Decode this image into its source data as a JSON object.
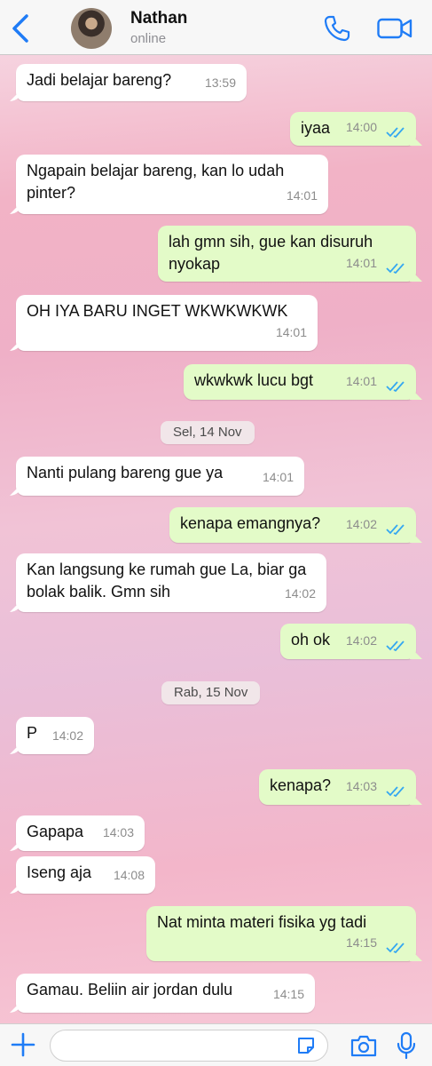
{
  "header": {
    "back_icon": "chevron-left-icon",
    "contact_name": "Nathan",
    "status": "online",
    "call_icon": "phone-icon",
    "video_icon": "video-camera-icon",
    "accent_color": "#1f7cf6"
  },
  "messages": [
    {
      "side": "in",
      "text": "Jadi belajar bareng?",
      "time": "13:59"
    },
    {
      "side": "out",
      "text": "iyaa",
      "time": "14:00",
      "read": true
    },
    {
      "side": "in",
      "text": "Ngapain belajar bareng, kan lo udah pinter?",
      "time": "14:01"
    },
    {
      "side": "out",
      "text": "lah gmn sih, gue kan disuruh nyokap",
      "time": "14:01",
      "read": true
    },
    {
      "side": "in",
      "text": "OH IYA BARU INGET WKWKWKWK",
      "time": "14:01"
    },
    {
      "side": "out",
      "text": "wkwkwk lucu bgt",
      "time": "14:01",
      "read": true
    },
    {
      "side": "date",
      "text": "Sel, 14 Nov"
    },
    {
      "side": "in",
      "text": "Nanti pulang bareng gue ya",
      "time": "14:01"
    },
    {
      "side": "out",
      "text": "kenapa emangnya?",
      "time": "14:02",
      "read": true
    },
    {
      "side": "in",
      "text": "Kan langsung ke rumah gue La, biar ga bolak balik. Gmn sih",
      "time": "14:02"
    },
    {
      "side": "out",
      "text": "oh ok",
      "time": "14:02",
      "read": true
    },
    {
      "side": "date",
      "text": "Rab, 15 Nov"
    },
    {
      "side": "in",
      "text": "P",
      "time": "14:02"
    },
    {
      "side": "out",
      "text": "kenapa?",
      "time": "14:03",
      "read": true
    },
    {
      "side": "in",
      "text": "Gapapa",
      "time": "14:03"
    },
    {
      "side": "in",
      "text": "Iseng aja",
      "time": "14:08"
    },
    {
      "side": "out",
      "text": "Nat minta materi fisika yg tadi",
      "time": "14:15",
      "read": true
    },
    {
      "side": "in",
      "text": "Gamau. Beliin air jordan dulu",
      "time": "14:15"
    }
  ],
  "composer": {
    "placeholder": "",
    "plus_icon": "plus-icon",
    "sticker_icon": "sticker-icon",
    "camera_icon": "camera-icon",
    "mic_icon": "microphone-icon"
  },
  "colors": {
    "outgoing_bubble": "#e3fbc8",
    "incoming_bubble": "#ffffff",
    "read_ticks": "#34a7f1"
  }
}
